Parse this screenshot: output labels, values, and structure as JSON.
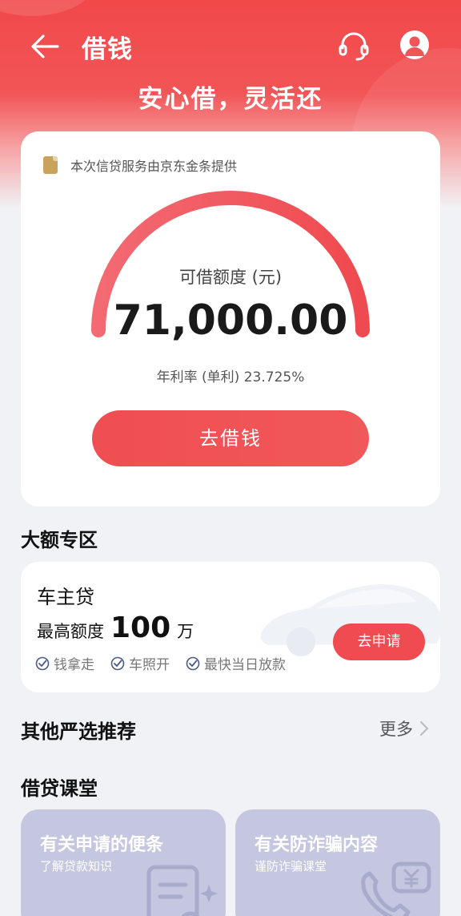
{
  "header": {
    "title": "借钱",
    "slogan": "安心借，灵活还"
  },
  "main_card": {
    "provider": "本次信贷服务由京东金条提供",
    "quota_label": "可借额度 (元)",
    "quota_amount": "71,000.00",
    "rate": "年利率 (单利) 23.725%",
    "borrow_button": "去借钱",
    "colors": {
      "gauge_start": "#f36a73",
      "gauge_end": "#ef4a4f"
    }
  },
  "large_section": {
    "title": "大额专区",
    "product": {
      "name": "车主贷",
      "quota_label": "最高额度",
      "quota_value": "100",
      "quota_unit": "万",
      "features": [
        "钱拿走",
        "车照开",
        "最快当日放款"
      ],
      "apply_button": "去申请"
    }
  },
  "other_section": {
    "title": "其他严选推荐",
    "more": "更多"
  },
  "class_section": {
    "title": "借贷课堂",
    "cards": [
      {
        "title": "有关申请的便条",
        "subtitle": "了解贷款知识",
        "icon": "document-icon"
      },
      {
        "title": "有关防诈骗内容",
        "subtitle": "谨防诈骗课堂",
        "icon": "phone-yuan-icon"
      }
    ]
  },
  "colors": {
    "brand_red": "#f1484a",
    "button_red": "#ef4b50",
    "class_card": "#c5c6e0",
    "background": "#f1f2f5"
  }
}
